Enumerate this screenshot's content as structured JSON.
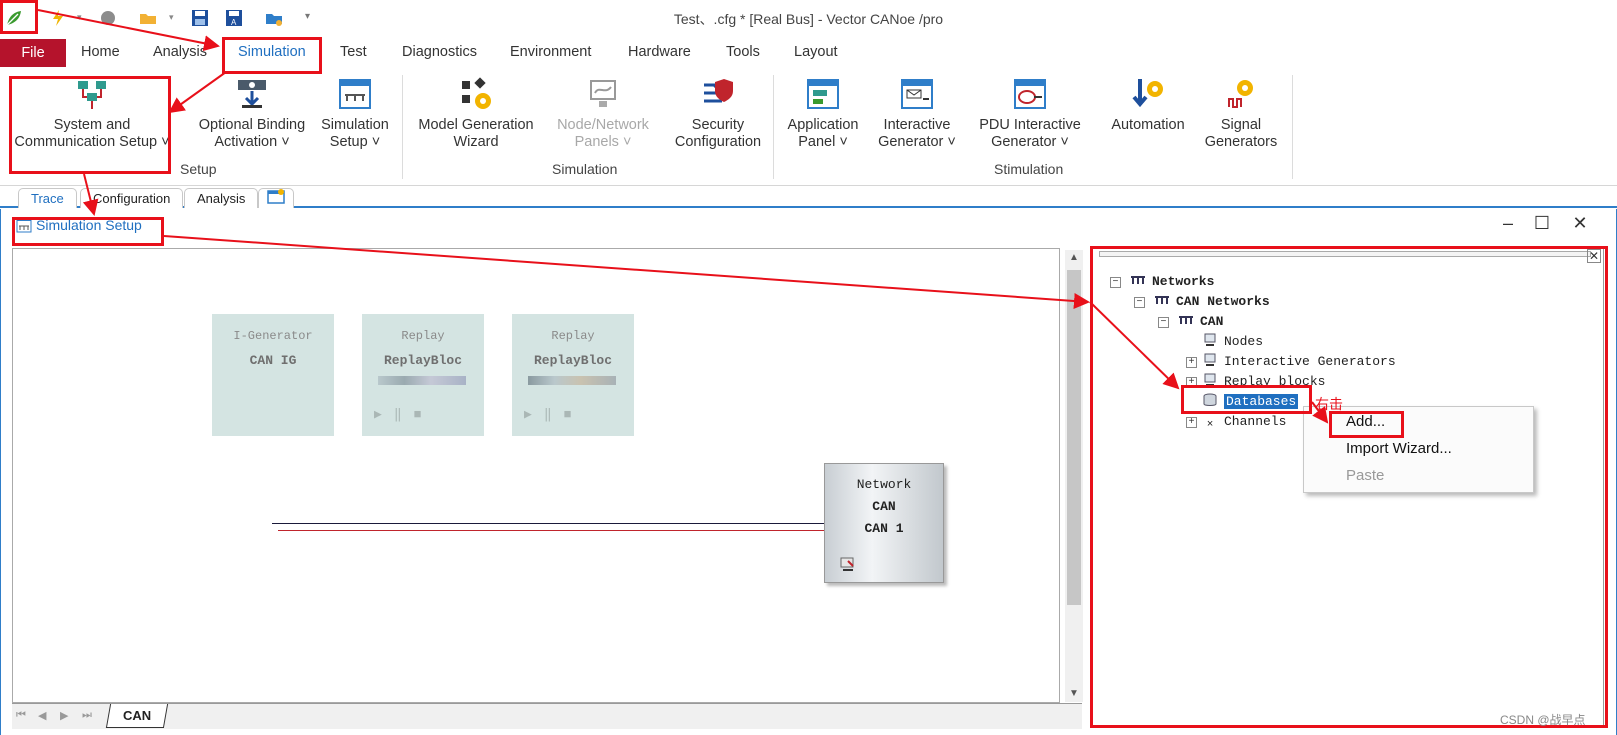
{
  "window_title": "Test、.cfg * [Real Bus] - Vector CANoe /pro",
  "colors": {
    "accent": "#2f7ec9",
    "file_tab": "#b5132c",
    "annotation": "#e8101a"
  },
  "quick_access": [
    {
      "icon": "canoe-leaf-icon"
    },
    {
      "icon": "lightning-icon"
    },
    {
      "icon": "stop-circle-icon"
    },
    {
      "icon": "open-folder-icon"
    },
    {
      "icon": "save-icon"
    },
    {
      "icon": "save-as-icon"
    },
    {
      "icon": "folder-config-icon"
    },
    {
      "icon": "customize-dropdown-icon"
    }
  ],
  "menu": {
    "file": "File",
    "tabs": [
      "Home",
      "Analysis",
      "Simulation",
      "Test",
      "Diagnostics",
      "Environment",
      "Hardware",
      "Tools",
      "Layout"
    ],
    "active": "Simulation"
  },
  "ribbon": {
    "buttons": [
      {
        "line1": "System and",
        "line2": "Communication Setup ˅",
        "icon": "system-communication-setup-icon"
      },
      {
        "line1": "Optional Binding",
        "line2": "Activation ˅",
        "icon": "optional-binding-icon"
      },
      {
        "line1": "Simulation",
        "line2": "Setup ˅",
        "icon": "simulation-setup-icon"
      },
      {
        "line1": "Model Generation",
        "line2": "Wizard",
        "icon": "model-generation-icon"
      },
      {
        "line1": "Node/Network",
        "line2": "Panels ˅",
        "icon": "node-network-panels-icon",
        "disabled": true
      },
      {
        "line1": "Security",
        "line2": "Configuration",
        "icon": "security-configuration-icon"
      },
      {
        "line1": "Application",
        "line2": "Panel ˅",
        "icon": "application-panel-icon"
      },
      {
        "line1": "Interactive",
        "line2": "Generator ˅",
        "icon": "interactive-generator-icon"
      },
      {
        "line1": "PDU Interactive",
        "line2": "Generator ˅",
        "icon": "pdu-interactive-generator-icon"
      },
      {
        "line1": "Automation",
        "line2": "",
        "icon": "automation-icon"
      },
      {
        "line1": "Signal",
        "line2": "Generators",
        "icon": "signal-generators-icon"
      }
    ],
    "groups": [
      "Setup",
      "Simulation",
      "Stimulation"
    ]
  },
  "doc_tabs": [
    "Trace",
    "Configuration",
    "Analysis"
  ],
  "sim_window": {
    "title": "Simulation Setup",
    "controls": {
      "minimize": "–",
      "maximize": "☐",
      "close": "✕"
    }
  },
  "canvas": {
    "blocks": [
      {
        "kind": "I-Generator",
        "name": "CAN IG"
      },
      {
        "kind": "Replay",
        "name": "ReplayBloc"
      },
      {
        "kind": "Replay",
        "name": "ReplayBloc"
      }
    ],
    "playback_controls": "▶‖■",
    "network": {
      "line1": "Network",
      "line2": "CAN",
      "line3": "CAN 1"
    },
    "bottom_tab": "CAN"
  },
  "tree": {
    "items": [
      {
        "label": "Networks",
        "bold": true
      },
      {
        "label": "CAN Networks",
        "bold": true
      },
      {
        "label": "CAN",
        "bold": true
      },
      {
        "label": "Nodes"
      },
      {
        "label": "Interactive Generators"
      },
      {
        "label": "Replay blocks"
      },
      {
        "label": "Databases",
        "selected": true
      },
      {
        "label": "Channels"
      }
    ]
  },
  "context_menu": {
    "items": [
      "Add...",
      "Import Wizard...",
      "Paste"
    ],
    "disabled": [
      "Paste"
    ]
  },
  "annotation": {
    "right_click_label": "右击"
  },
  "watermark": "CSDN @战早点"
}
